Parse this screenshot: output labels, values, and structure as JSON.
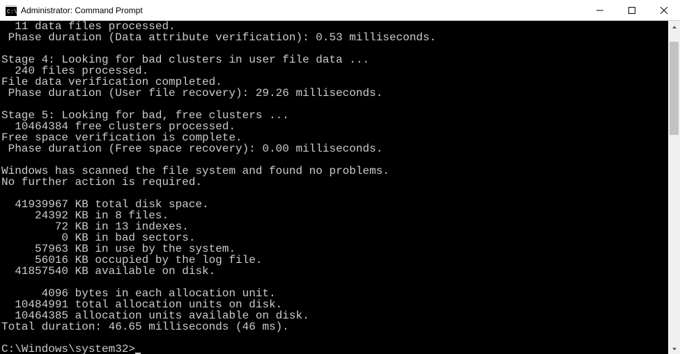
{
  "window": {
    "title": "Administrator: Command Prompt",
    "icon": "cmd-icon"
  },
  "titlebar": {
    "minimize_label": "Minimize",
    "maximize_label": "Maximize",
    "close_label": "Close"
  },
  "scrollbar": {
    "thumb_top_pct": 3,
    "thumb_height_pct": 30
  },
  "terminal": {
    "prompt": "C:\\Windows\\system32>",
    "lines": [
      "  11 data files processed.",
      " Phase duration (Data attribute verification): 0.53 milliseconds.",
      "",
      "Stage 4: Looking for bad clusters in user file data ...",
      "  240 files processed.",
      "File data verification completed.",
      " Phase duration (User file recovery): 29.26 milliseconds.",
      "",
      "Stage 5: Looking for bad, free clusters ...",
      "  10464384 free clusters processed.",
      "Free space verification is complete.",
      " Phase duration (Free space recovery): 0.00 milliseconds.",
      "",
      "Windows has scanned the file system and found no problems.",
      "No further action is required.",
      "",
      "  41939967 KB total disk space.",
      "     24392 KB in 8 files.",
      "        72 KB in 13 indexes.",
      "         0 KB in bad sectors.",
      "     57963 KB in use by the system.",
      "     56016 KB occupied by the log file.",
      "  41857540 KB available on disk.",
      "",
      "      4096 bytes in each allocation unit.",
      "  10484991 total allocation units on disk.",
      "  10464385 allocation units available on disk.",
      "Total duration: 46.65 milliseconds (46 ms).",
      ""
    ]
  }
}
